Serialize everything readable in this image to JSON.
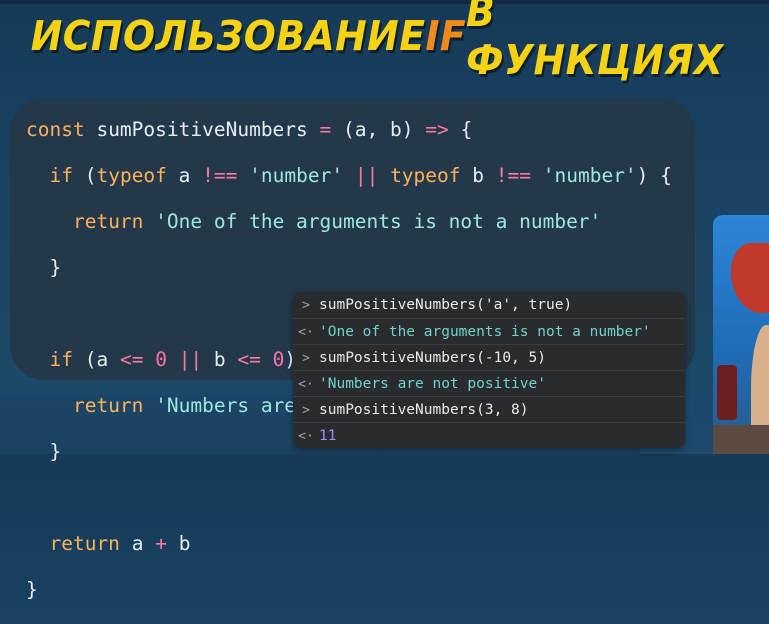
{
  "slide": {
    "title_part1": "ИСПОЛЬЗОВАНИЕ ",
    "title_highlight": "IF",
    "title_part2": " В ФУНКЦИЯХ"
  },
  "code": {
    "lines": [
      "const sumPositiveNumbers = (a, b) => {",
      "  if (typeof a !== 'number' || typeof b !== 'number') {",
      "    return 'One of the arguments is not a number'",
      "  }",
      "",
      "  if (a <= 0 || b <= 0) {",
      "    return 'Numbers are not positive'",
      "  }",
      "",
      "  return a + b",
      "}"
    ]
  },
  "console": {
    "entries": [
      {
        "type": "input",
        "prefix": ">",
        "text": "sumPositiveNumbers('a', true)"
      },
      {
        "type": "output",
        "prefix": "<·",
        "text": "'One of the arguments is not a number'"
      },
      {
        "type": "input",
        "prefix": ">",
        "text": "sumPositiveNumbers(-10, 5)"
      },
      {
        "type": "output",
        "prefix": "<·",
        "text": "'Numbers are not positive'"
      },
      {
        "type": "input",
        "prefix": ">",
        "text": "sumPositiveNumbers(3, 8)"
      },
      {
        "type": "output",
        "prefix": "<·",
        "text": "11"
      }
    ]
  },
  "colors": {
    "title_yellow": "#f6d214",
    "title_orange": "#f08a1b",
    "code_background": "#23394b",
    "console_background": "#2a2b2e"
  }
}
